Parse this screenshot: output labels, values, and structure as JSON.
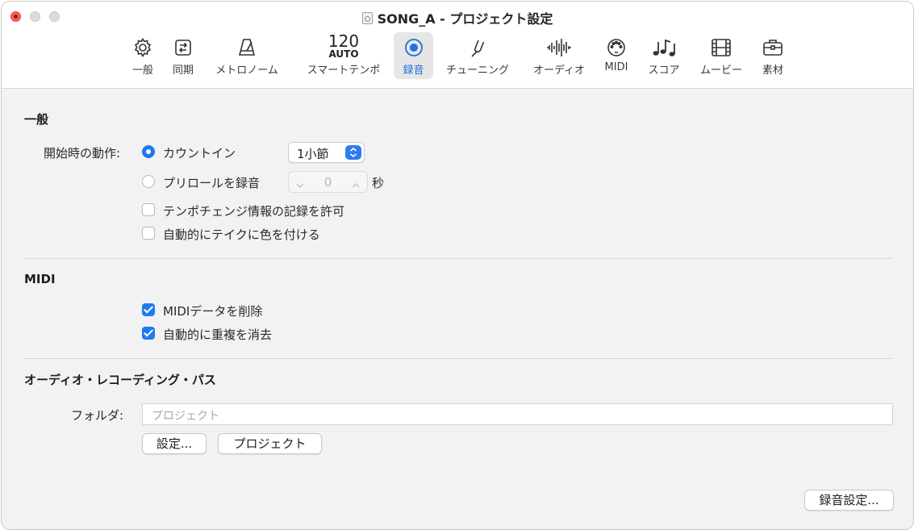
{
  "window": {
    "title": "SONG_A - プロジェクト設定"
  },
  "toolbar": {
    "items": [
      {
        "label": "一般",
        "icon": "gear-icon"
      },
      {
        "label": "同期",
        "icon": "sync-icon"
      },
      {
        "label": "メトロノーム",
        "icon": "metronome-icon"
      },
      {
        "label": "スマートテンポ",
        "icon": "smart-tempo-icon",
        "icon_text_top": "120",
        "icon_text_bottom": "AUTO"
      },
      {
        "label": "録音",
        "icon": "record-icon",
        "active": true
      },
      {
        "label": "チューニング",
        "icon": "tuning-fork-icon"
      },
      {
        "label": "オーディオ",
        "icon": "waveform-icon"
      },
      {
        "label": "MIDI",
        "icon": "midi-port-icon"
      },
      {
        "label": "スコア",
        "icon": "music-notes-icon"
      },
      {
        "label": "ムービー",
        "icon": "film-icon"
      },
      {
        "label": "素材",
        "icon": "briefcase-icon"
      }
    ]
  },
  "general": {
    "title": "一般",
    "start_action_label": "開始時の動作:",
    "count_in_label": "カウントイン",
    "count_in_value": "1小節",
    "preroll_label": "プリロールを録音",
    "preroll_value": "0",
    "preroll_unit": "秒",
    "tempo_change_label": "テンポチェンジ情報の記録を許可",
    "auto_color_label": "自動的にテイクに色を付ける"
  },
  "midi": {
    "title": "MIDI",
    "delete_midi_label": "MIDIデータを削除",
    "remove_overlap_label": "自動的に重複を消去"
  },
  "audio_path": {
    "title": "オーディオ・レコーディング・パス",
    "folder_label": "フォルダ:",
    "folder_placeholder": "プロジェクト",
    "set_button": "設定...",
    "project_button": "プロジェクト"
  },
  "footer": {
    "record_settings_button": "録音設定..."
  },
  "colors": {
    "accent": "#1f7af0",
    "close": "#fe5f57"
  }
}
